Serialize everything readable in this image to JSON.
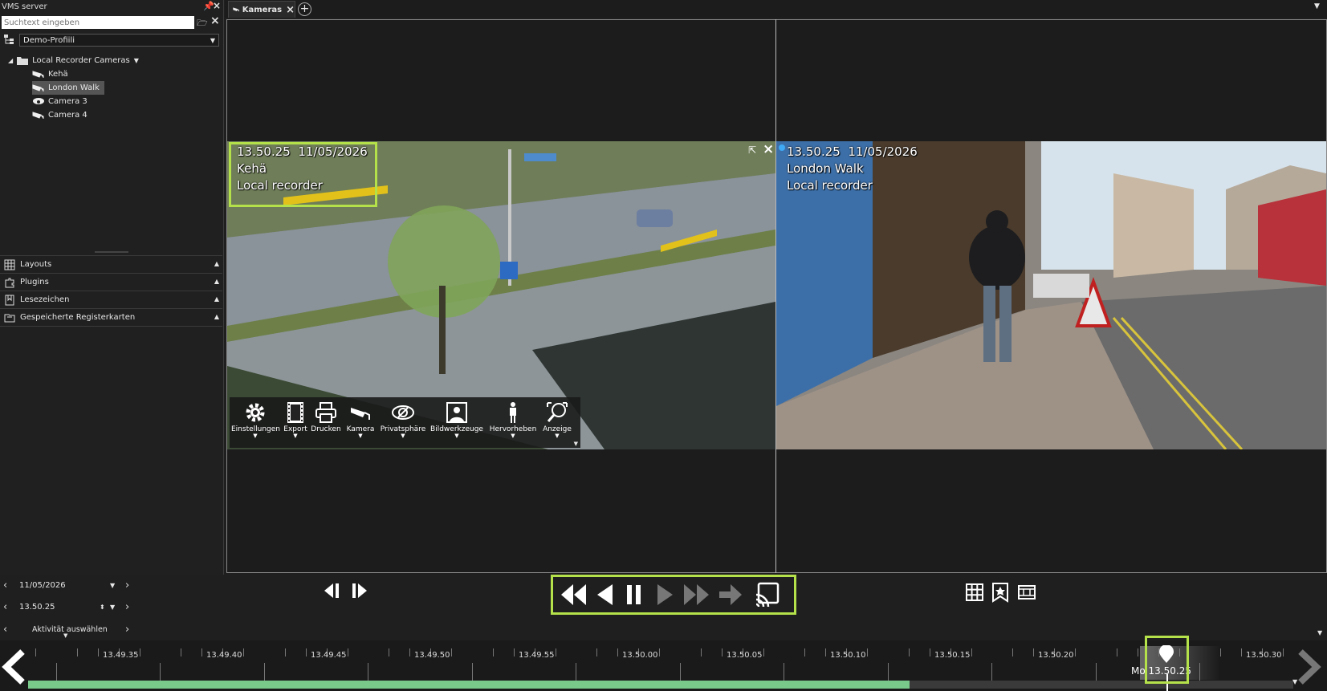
{
  "left_panel": {
    "title": "VMS server",
    "search_placeholder": "Suchtext eingeben",
    "profile": "Demo-Profiili",
    "tree": {
      "root": "Local Recorder Cameras",
      "cameras": [
        "Kehä",
        "London Walk",
        "Camera 3",
        "Camera 4"
      ],
      "selected": "London Walk"
    },
    "sections": [
      "Layouts",
      "Plugins",
      "Lesezeichen",
      "Gespeicherte Registerkarten"
    ]
  },
  "tabs": {
    "active": "Kameras"
  },
  "views": [
    {
      "time": "13.50.25",
      "date": "11/05/2026",
      "name": "Kehä",
      "source": "Local recorder"
    },
    {
      "time": "13.50.25",
      "date": "11/05/2026",
      "name": "London Walk",
      "source": "Local recorder"
    }
  ],
  "toolbar": [
    "Einstellungen",
    "Export",
    "Drucken",
    "Kamera",
    "Privatsphäre",
    "Bildwerkzeuge",
    "Hervorheben",
    "Anzeige"
  ],
  "bottom": {
    "date": "11/05/2026",
    "time": "13.50.25",
    "activity": "Aktivität auswählen"
  },
  "timeline": {
    "labels": [
      "13.49.35",
      "13.49.40",
      "13.49.45",
      "13.49.50",
      "13.49.55",
      "13.50.00",
      "13.50.05",
      "13.50.10",
      "13.50.15",
      "13.50.20",
      "13.50.30"
    ],
    "cursor_prefix": "Mo",
    "cursor_time": "13.50.25"
  },
  "colors": {
    "highlight": "#b4e04a",
    "recording": "#79c98b",
    "status_dot": "#3fa9f5"
  }
}
